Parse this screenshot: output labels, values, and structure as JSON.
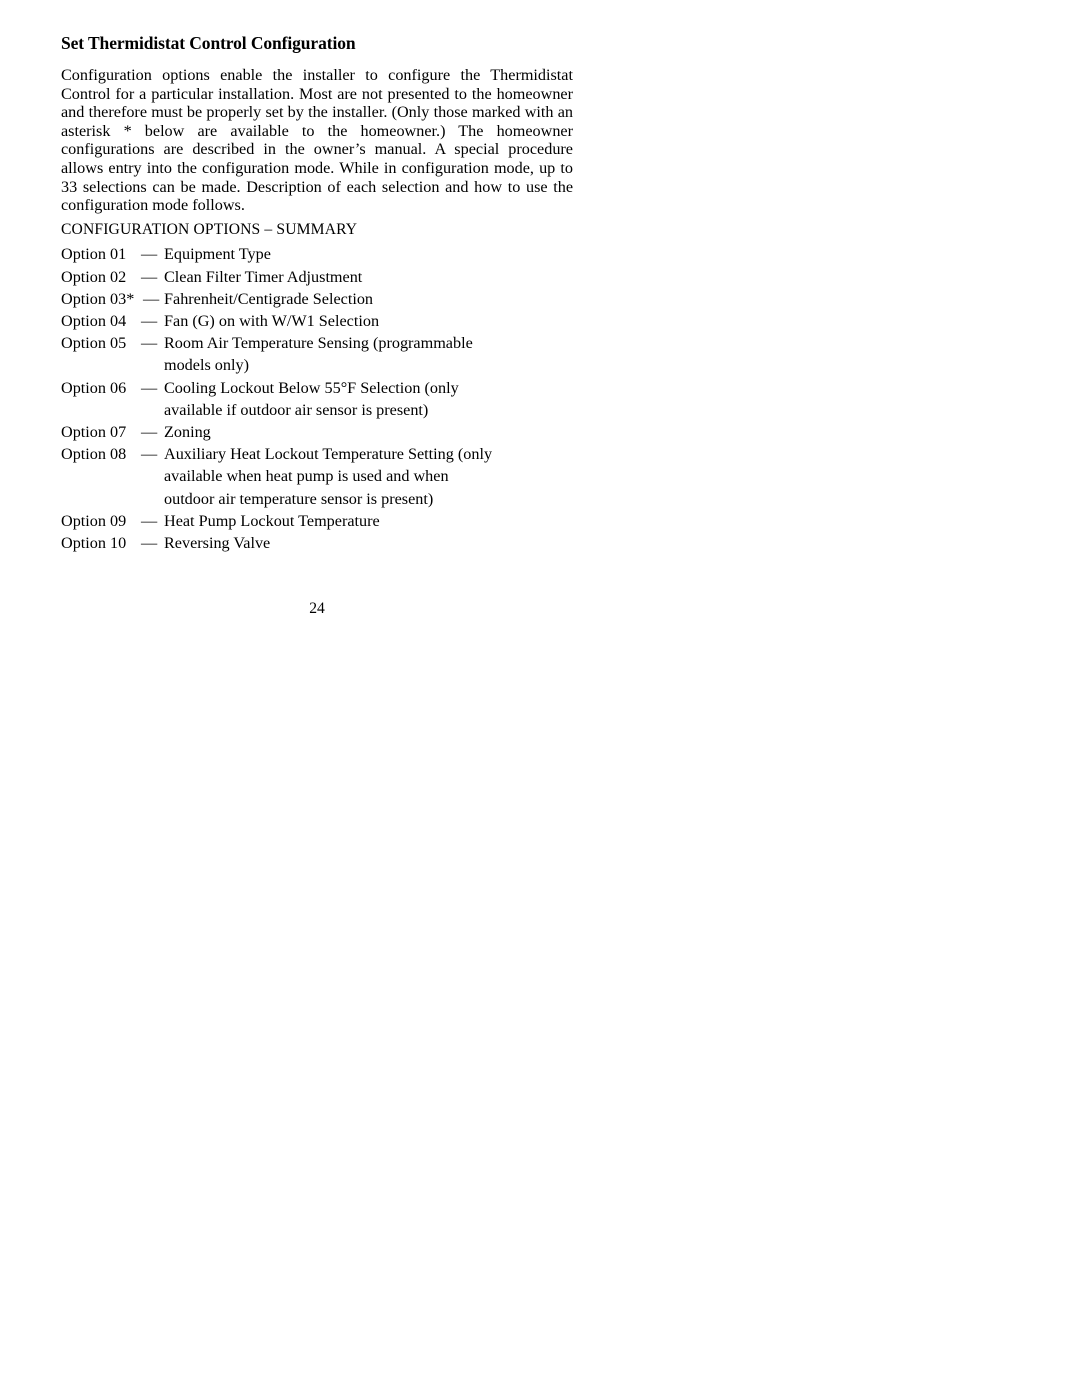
{
  "document": {
    "title": "Set Thermidistat Control Configuration",
    "intro_paragraph": "Configuration options enable the installer to configure the Thermidistat Control for a particular installation. Most are not presented to the homeowner and therefore must be properly set by the installer. (Only those marked with an asterisk * below are available to the homeowner.) The homeowner configurations are described in the owner’s manual. A special procedure allows entry into the configuration mode. While in configuration mode, up to 33 selections can be made. Description of each selection and how to use the configuration mode follows.",
    "section_heading": "CONFIGURATION OPTIONS – SUMMARY",
    "page_number": "24",
    "options": [
      {
        "label": "Option 01",
        "dash": "—",
        "description": "Equipment Type"
      },
      {
        "label": "Option 02",
        "dash": "—",
        "description": "Clean Filter Timer Adjustment"
      },
      {
        "label": "Option 03*",
        "dash": "—",
        "description": "Fahrenheit/Centigrade Selection"
      },
      {
        "label": "Option 04",
        "dash": "—",
        "description": "Fan (G) on with W/W1 Selection"
      },
      {
        "label": "Option 05",
        "dash": "—",
        "description": "Room Air Temperature Sensing (programmable\nmodels only)"
      },
      {
        "label": "Option 06",
        "dash": "—",
        "description": "Cooling Lockout Below 55°F Selection (only\navailable if outdoor air sensor is present)"
      },
      {
        "label": "Option 07",
        "dash": "—",
        "description": "Zoning"
      },
      {
        "label": "Option 08",
        "dash": "—",
        "description": "Auxiliary Heat Lockout Temperature Setting (only\navailable when heat pump is used and when\noutdoor air temperature sensor is present)"
      },
      {
        "label": "Option 09",
        "dash": "—",
        "description": "Heat Pump Lockout Temperature"
      },
      {
        "label": "Option 10",
        "dash": "—",
        "description": "Reversing Valve"
      }
    ]
  }
}
